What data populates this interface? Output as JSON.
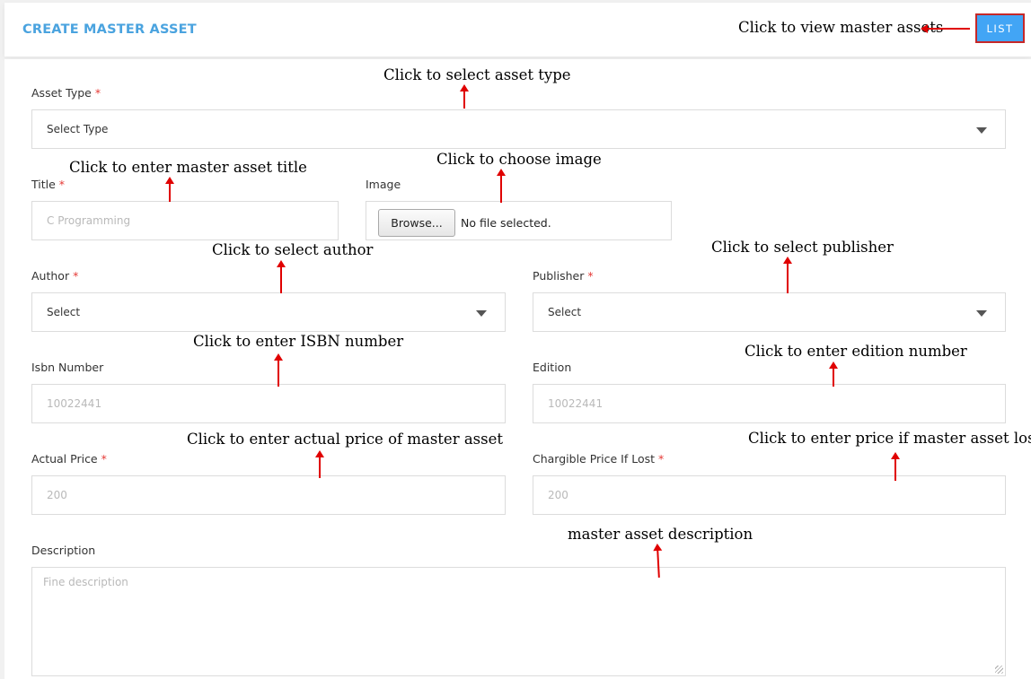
{
  "header": {
    "title": "CREATE MASTER ASSET",
    "list_button": "LIST"
  },
  "form": {
    "asset_type": {
      "label": "Asset Type",
      "required_mark": "*",
      "value": "Select Type"
    },
    "title": {
      "label": "Title",
      "required_mark": "*",
      "placeholder": "C Programming"
    },
    "image": {
      "label": "Image",
      "browse": "Browse...",
      "status": "No file selected."
    },
    "author": {
      "label": "Author",
      "required_mark": "*",
      "value": "Select"
    },
    "publisher": {
      "label": "Publisher",
      "required_mark": "*",
      "value": "Select"
    },
    "isbn": {
      "label": "Isbn Number",
      "placeholder": "10022441"
    },
    "edition": {
      "label": "Edition",
      "placeholder": "10022441"
    },
    "actual_price": {
      "label": "Actual Price",
      "required_mark": "*",
      "placeholder": "200"
    },
    "chargible_price": {
      "label": "Chargible Price If Lost",
      "required_mark": "*",
      "placeholder": "200"
    },
    "description": {
      "label": "Description",
      "placeholder": "Fine description"
    }
  },
  "annotations": {
    "list": "Click to view master assets",
    "asset_type": "Click to select asset type",
    "title": "Click to enter master asset title",
    "image": "Click to choose image",
    "author": "Click to select author",
    "publisher": "Click to select publisher",
    "isbn": "Click to enter ISBN number",
    "edition": "Click to enter edition number",
    "actual_price": "Click to enter actual price of master asset",
    "chargible_price": "Click to enter price if master asset lost",
    "description": "master asset description"
  },
  "colors": {
    "title": "#4aa3df",
    "button": "#42a5f5",
    "highlight": "#c62828",
    "arrow": "#e00000",
    "required": "#e53935"
  }
}
